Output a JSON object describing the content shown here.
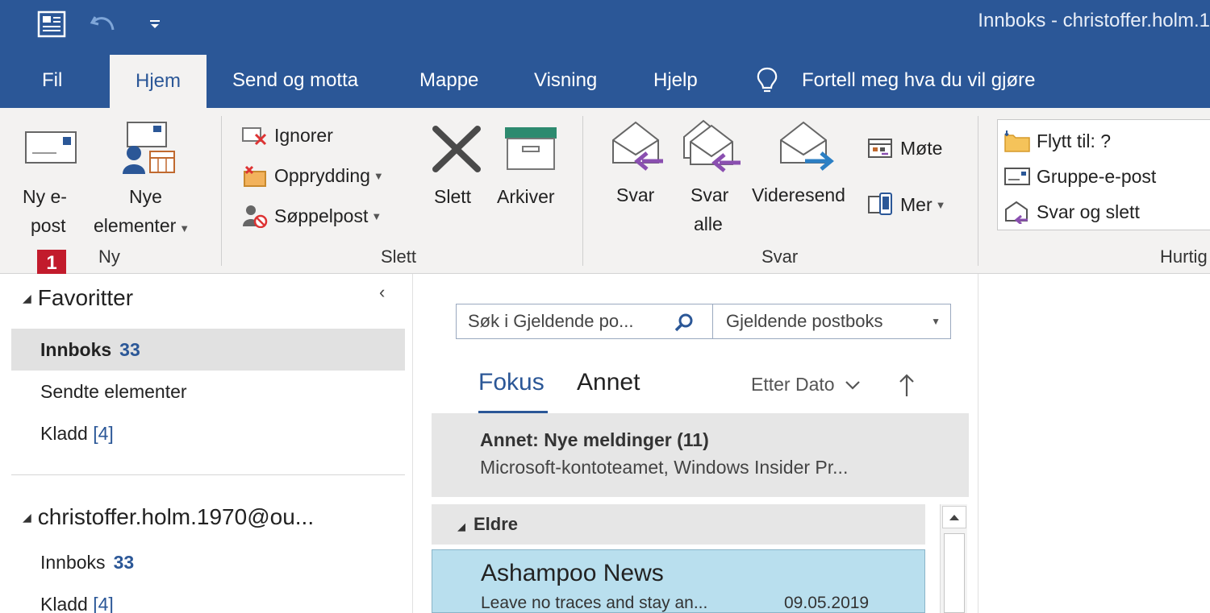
{
  "titlebar": {
    "title": "Innboks - christoffer.holm.1"
  },
  "tabs": [
    {
      "label": "Fil"
    },
    {
      "label": "Hjem"
    },
    {
      "label": "Send og motta"
    },
    {
      "label": "Mappe"
    },
    {
      "label": "Visning"
    },
    {
      "label": "Hjelp"
    },
    {
      "label": "Fortell meg hva du vil gjøre"
    }
  ],
  "ribbon": {
    "new": {
      "new_email_line1": "Ny e-",
      "new_email_line2": "post",
      "new_items_line1": "Nye",
      "new_items_line2": "elementer",
      "group": "Ny",
      "badge": "1"
    },
    "delete": {
      "ignore": "Ignorer",
      "cleanup": "Opprydding",
      "junk": "Søppelpost",
      "delete": "Slett",
      "archive": "Arkiver",
      "group": "Slett"
    },
    "respond": {
      "reply": "Svar",
      "reply_all_line1": "Svar",
      "reply_all_line2": "alle",
      "forward": "Videresend",
      "meeting": "Møte",
      "more": "Mer",
      "group": "Svar"
    },
    "quick": {
      "move_to": "Flytt til: ?",
      "group_email": "Gruppe-e-post",
      "reply_delete": "Svar og slett",
      "group": "Hurtig"
    }
  },
  "folders": {
    "favorites_header": "Favoritter",
    "favorites": [
      {
        "label": "Innboks",
        "count": "33"
      },
      {
        "label": "Sendte elementer",
        "count": ""
      },
      {
        "label": "Kladd",
        "count": "[4]"
      }
    ],
    "account_header": "christoffer.holm.1970@ou...",
    "account_items": [
      {
        "label": "Innboks",
        "count": "33"
      },
      {
        "label": "Kladd",
        "count": "[4]"
      }
    ]
  },
  "list": {
    "search_placeholder": "Søk i Gjeldende po...",
    "scope": "Gjeldende postboks",
    "tab_focus": "Fokus",
    "tab_other": "Annet",
    "sort_label": "Etter Dato",
    "other_banner_title": "Annet: Nye meldinger (11)",
    "other_banner_senders": "Microsoft-kontoteamet, Windows Insider Pr...",
    "group_header": "Eldre",
    "messages": [
      {
        "sender": "Ashampoo News",
        "preview": "Leave no traces and stay an...",
        "date": "09.05.2019"
      }
    ]
  },
  "colors": {
    "brand_blue": "#2b5797",
    "ribbon_bg": "#f3f2f1",
    "selected_message": "#b9dfee",
    "badge_red": "#c21b2c"
  }
}
